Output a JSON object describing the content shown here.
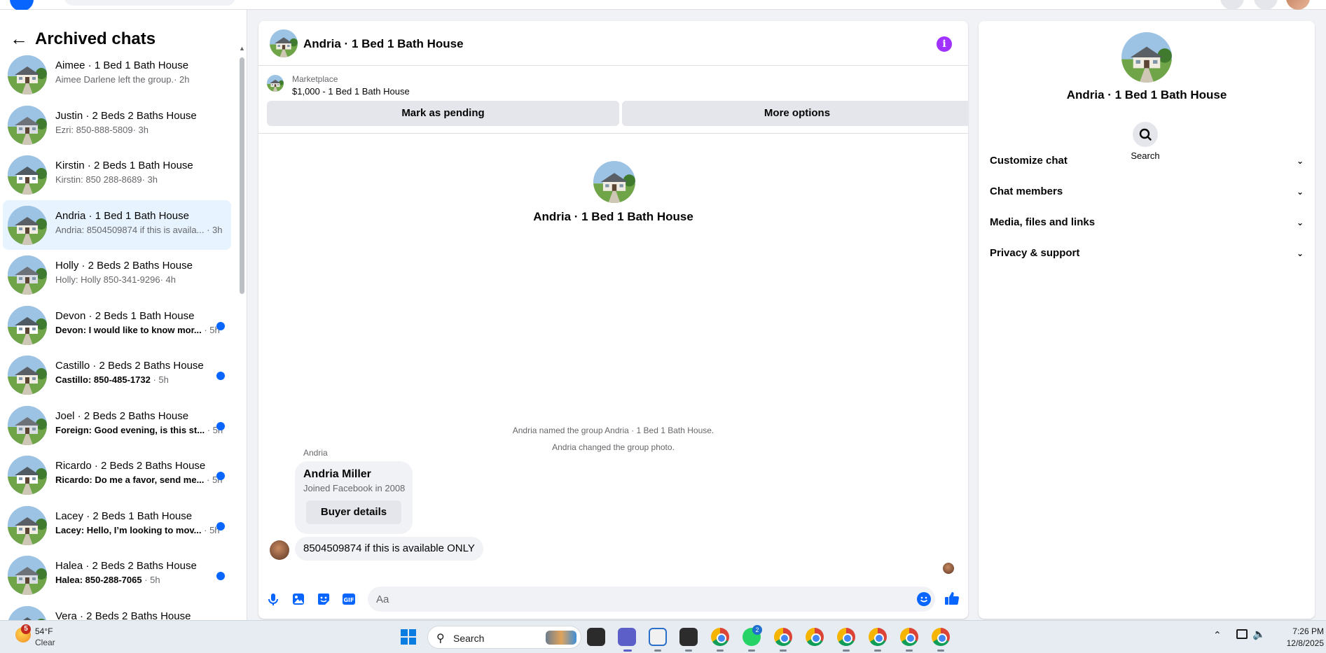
{
  "sidebar": {
    "title": "Archived chats",
    "chats": [
      {
        "name": "Aimee · 1 Bed 1 Bath House",
        "preview": "Aimee Darlene left the group.",
        "time": "· 2h",
        "unread": false,
        "active": false
      },
      {
        "name": "Justin · 2 Beds 2 Baths House",
        "preview": "Ezri: 850-888-5809",
        "time": "· 3h",
        "unread": false,
        "active": false
      },
      {
        "name": "Kirstin · 2 Beds 1 Bath House",
        "preview": "Kirstin: 850 288-8689",
        "time": "· 3h",
        "unread": false,
        "active": false
      },
      {
        "name": "Andria · 1 Bed 1 Bath House",
        "preview": "Andria: 8504509874 if this is availa...",
        "time": " · 3h",
        "unread": false,
        "active": true
      },
      {
        "name": "Holly · 2 Beds 2 Baths House",
        "preview": "Holly: Holly 850-341-9296",
        "time": "· 4h",
        "unread": false,
        "active": false
      },
      {
        "name": "Devon · 2 Beds 1 Bath House",
        "preview": "Devon: I would like to know mor...",
        "time": " · 5h",
        "unread": true,
        "active": false
      },
      {
        "name": "Castillo · 2 Beds 2 Baths House",
        "preview": "Castillo: 850-485-1732",
        "time": " · 5h",
        "unread": true,
        "active": false
      },
      {
        "name": "Joel · 2 Beds 2 Baths House",
        "preview": "Foreign: Good evening, is this st...",
        "time": " · 5h",
        "unread": true,
        "active": false
      },
      {
        "name": "Ricardo · 2 Beds 2 Baths House",
        "preview": "Ricardo: Do me a favor, send me...",
        "time": " · 5h",
        "unread": true,
        "active": false
      },
      {
        "name": "Lacey · 2 Beds 1 Bath House",
        "preview": "Lacey: Hello, I’m looking to mov...",
        "time": " · 5h",
        "unread": true,
        "active": false
      },
      {
        "name": "Halea · 2 Beds 2 Baths House",
        "preview": "Halea: 850-288-7065",
        "time": " · 5h",
        "unread": true,
        "active": false
      },
      {
        "name": "Vera · 2 Beds 2 Baths House",
        "preview": "",
        "time": "",
        "unread": true,
        "active": false
      }
    ]
  },
  "chat": {
    "title": "Andria · 1 Bed 1 Bath House",
    "marketplace_label": "Marketplace",
    "listing": "$1,000 - 1 Bed 1 Bath House",
    "mark_pending": "Mark as pending",
    "more_options": "More options",
    "intro_name": "Andria · 1 Bed 1 Bath House",
    "system_1": "Andria named the group Andria · 1 Bed 1 Bath House.",
    "system_2": "Andria changed the group photo.",
    "sender": "Andria",
    "card_name": "Andria Miller",
    "card_sub": "Joined Facebook in 2008",
    "card_button": "Buyer details",
    "message": "8504509874 if this is available ONLY",
    "composer_placeholder": "Aa",
    "gif_label": "GIF"
  },
  "details": {
    "name": "Andria · 1 Bed 1 Bath House",
    "search_label": "Search",
    "sections": [
      "Customize chat",
      "Chat members",
      "Media, files and links",
      "Privacy & support"
    ]
  },
  "taskbar": {
    "weather_badge": "5",
    "temperature": "54°F",
    "condition": "Clear",
    "search_label": "Search",
    "whatsapp_badge": "2",
    "time": "7:26 PM",
    "date": "12/8/2025"
  },
  "colors": {
    "accent": "#0866ff",
    "active_chat": "#e7f3ff",
    "info_icon": "#a033ff"
  }
}
